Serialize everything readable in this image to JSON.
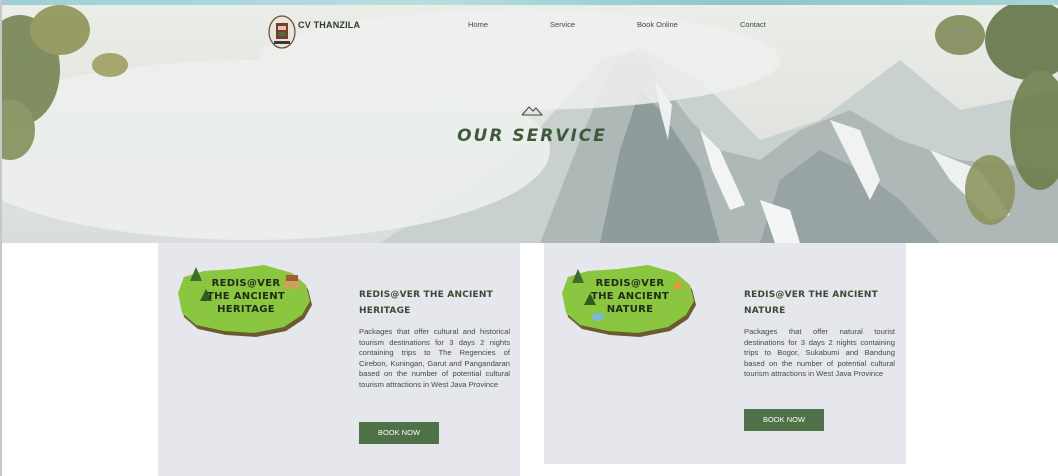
{
  "nav": {
    "brand": "CV THANZILA",
    "links": [
      "Home",
      "Service",
      "Book Online",
      "Contact"
    ]
  },
  "hero": {
    "title": "OUR SERVICE",
    "icon": "mountain-outline-icon"
  },
  "cards": [
    {
      "title": "REDIS@VER THE ANCIENT HERITAGE",
      "image_text": [
        "REDIS@VER",
        "THE ANCIENT",
        "HERITAGE"
      ],
      "description": "Packages that offer cultural and historical tourism destinations for 3 days 2 nights containing trips to The Regencies of Cirebon, Kuningan, Garut and Pangandaran based on the number of potential cultural tourism attractions in West Java Province",
      "button": "BOOK NOW"
    },
    {
      "title": "REDIS@VER THE ANCIENT NATURE",
      "image_text": [
        "REDIS@VER",
        "THE ANCIENT",
        "NATURE"
      ],
      "description": "Packages that offer natural tourist destinations for 3 days 2 nights containing trips to Bogor, Sukabumi and Bandung based on the number of potential cultural tourism attractions in West Java Province",
      "button": "BOOK NOW"
    }
  ],
  "colors": {
    "accent": "#4f7147",
    "card_bg": "#e6e7ec",
    "title_text": "#3f5a3a"
  }
}
